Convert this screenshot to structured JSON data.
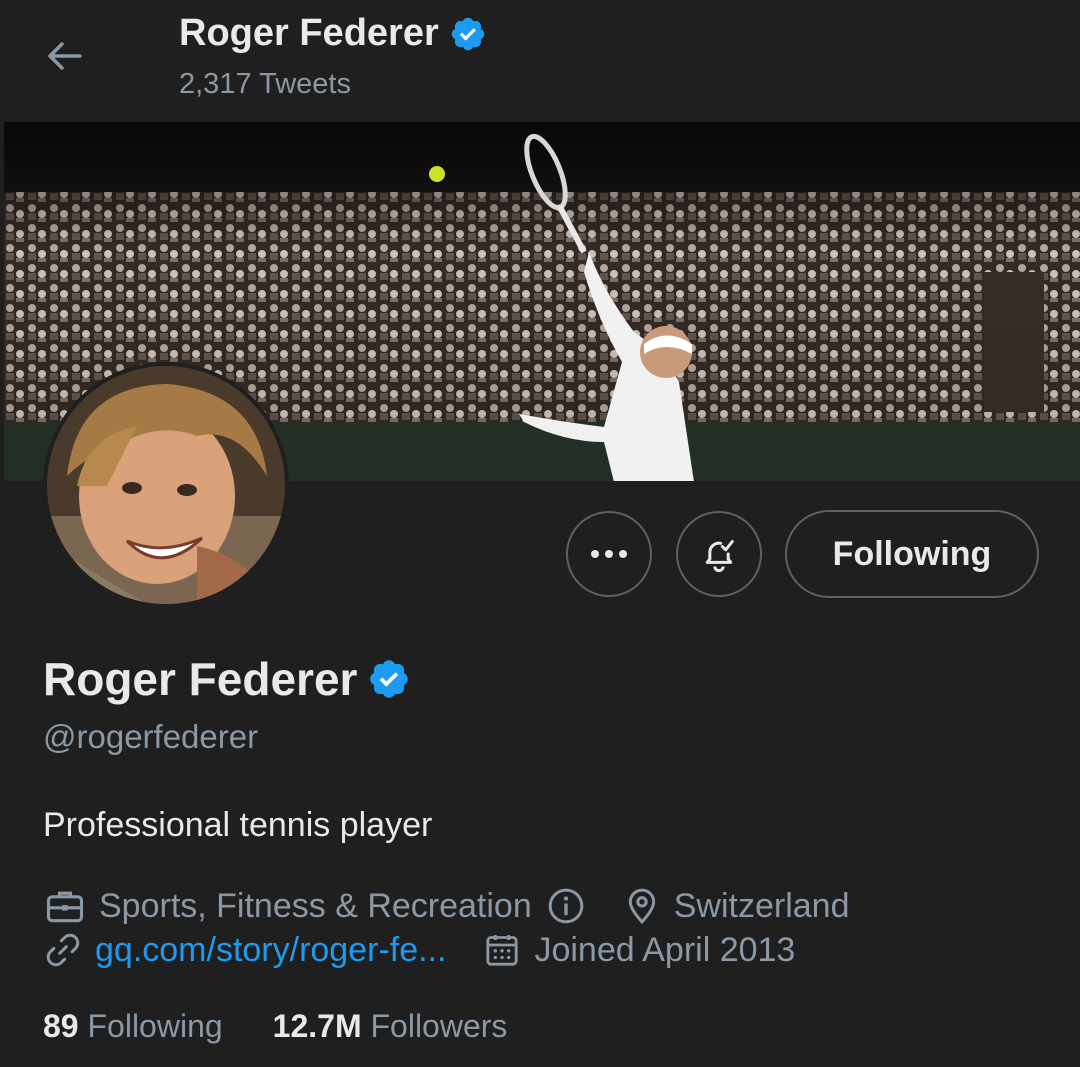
{
  "header": {
    "title": "Roger Federer",
    "tweet_count": "2,317 Tweets"
  },
  "profile": {
    "name": "Roger Federer",
    "handle": "@rogerfederer",
    "bio": "Professional tennis player",
    "category": "Sports, Fitness & Recreation",
    "location": "Switzerland",
    "website": "gq.com/story/roger-fe...",
    "joined": "Joined April 2013"
  },
  "actions": {
    "follow_label": "Following"
  },
  "stats": {
    "following_count": "89",
    "following_label": "Following",
    "followers_count": "12.7M",
    "followers_label": "Followers"
  },
  "colors": {
    "background": "#1f1f1f",
    "text": "#e7e9ea",
    "muted": "#8b98a5",
    "accent": "#1d9bf0"
  },
  "icons": {
    "back": "arrow-left-icon",
    "verified": "verified-badge-icon",
    "more": "more-icon",
    "notifications": "bell-check-icon",
    "category": "briefcase-icon",
    "info": "info-icon",
    "location": "location-pin-icon",
    "link": "link-icon",
    "calendar": "calendar-icon"
  }
}
